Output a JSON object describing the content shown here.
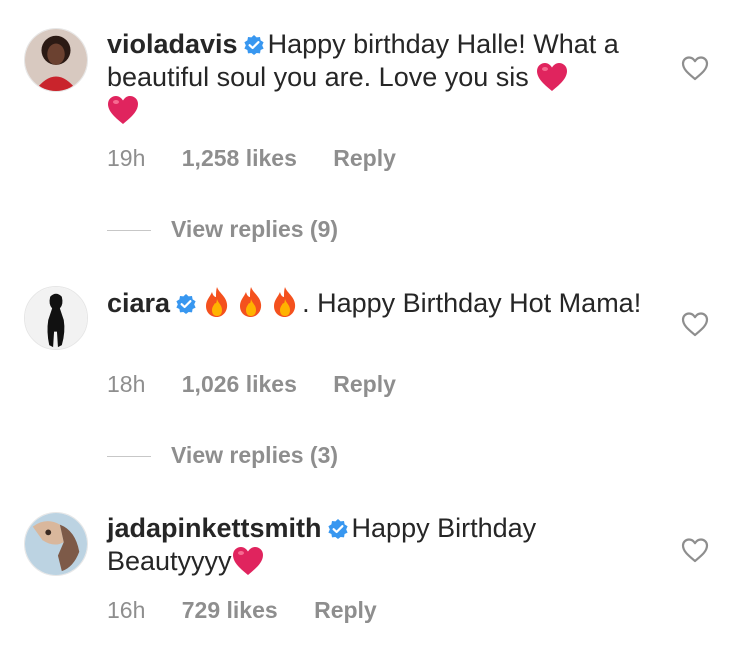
{
  "comments": [
    {
      "username": "violadavis",
      "verified": true,
      "text_main": "Happy birthday Halle! What a beautiful soul you are. Love you sis",
      "emoji_after": [
        "heart",
        "heart"
      ],
      "time": "19h",
      "likes": "1,258 likes",
      "reply": "Reply",
      "view_replies": "View replies (9)"
    },
    {
      "username": "ciara",
      "verified": true,
      "emoji_before": [
        "fire",
        "fire",
        "fire"
      ],
      "text_main": ". Happy Birthday Hot Mama!",
      "time": "18h",
      "likes": "1,026 likes",
      "reply": "Reply",
      "view_replies": "View replies (3)"
    },
    {
      "username": "jadapinkettsmith",
      "verified": true,
      "text_main": "Happy Birthday Beautyyyy",
      "emoji_after": [
        "heart"
      ],
      "time": "16h",
      "likes": "729 likes",
      "reply": "Reply"
    }
  ],
  "icons": {
    "verified": "verified-badge-icon",
    "like": "heart-outline-icon"
  },
  "colors": {
    "text": "#262626",
    "secondary": "#8e8e8e",
    "verified_blue": "#3897f0",
    "heart_red": "#e0245e",
    "divider": "#c7c7c7"
  }
}
